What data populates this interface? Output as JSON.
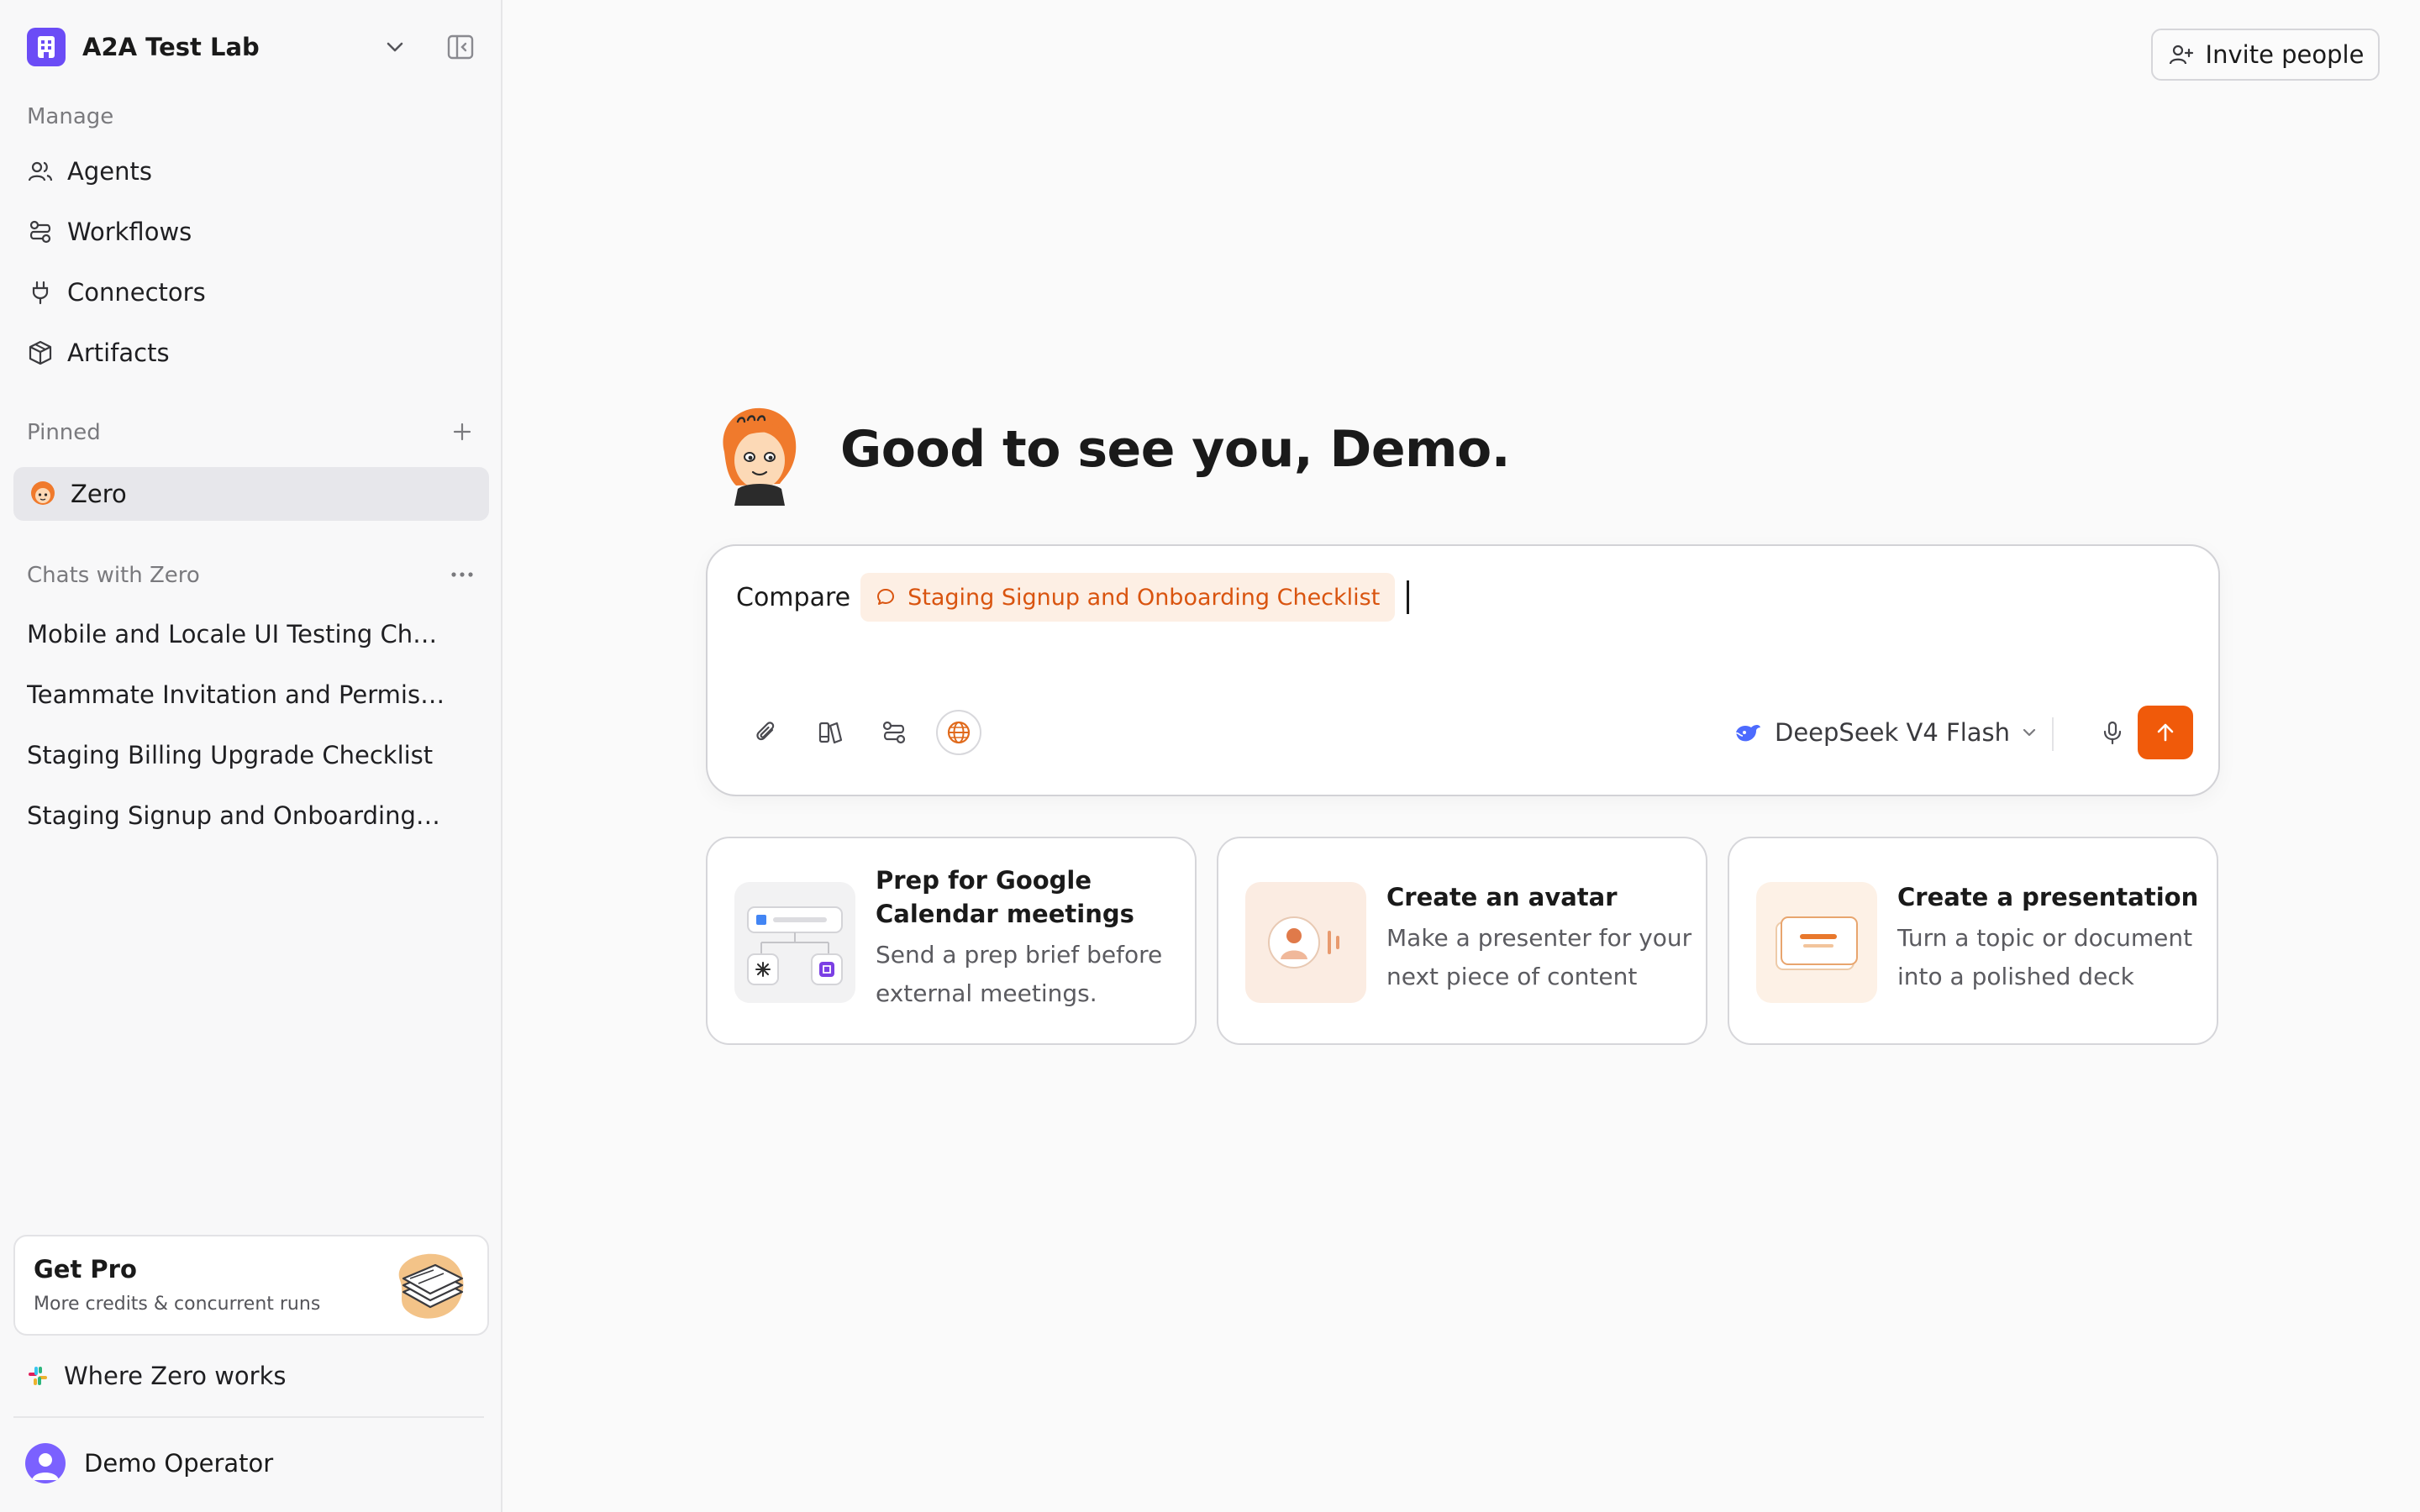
{
  "workspace": {
    "name": "A2A Test Lab"
  },
  "sidebar": {
    "manage_label": "Manage",
    "nav": [
      {
        "label": "Agents",
        "icon": "users-icon"
      },
      {
        "label": "Workflows",
        "icon": "workflow-icon"
      },
      {
        "label": "Connectors",
        "icon": "plug-icon"
      },
      {
        "label": "Artifacts",
        "icon": "cube-icon"
      }
    ],
    "pinned_label": "Pinned",
    "pinned_item": "Zero",
    "chats_label": "Chats with Zero",
    "chats": [
      "Mobile and Locale UI Testing Chec...",
      "Teammate Invitation and Permissi...",
      "Staging Billing Upgrade Checklist",
      "Staging Signup and Onboarding C..."
    ],
    "pro": {
      "title": "Get Pro",
      "subtitle": "More credits & concurrent runs"
    },
    "where_zero": "Where Zero works",
    "user": "Demo Operator"
  },
  "header": {
    "invite_label": "Invite people"
  },
  "main": {
    "greeting": "Good to see you, Demo.",
    "composer": {
      "text": "Compare",
      "mention": "Staging Signup and Onboarding Checklist",
      "model": "DeepSeek V4 Flash"
    },
    "cards": [
      {
        "title": "Prep for Google Calendar meetings",
        "desc": "Send a prep brief before external meetings."
      },
      {
        "title": "Create an avatar",
        "desc": "Make a presenter for your next piece of content"
      },
      {
        "title": "Create a presentation",
        "desc": "Turn a topic or document into a polished deck"
      }
    ]
  },
  "colors": {
    "accent": "#f05a0a",
    "brand": "#6b4cf6",
    "mention_bg": "#fdefe4"
  }
}
